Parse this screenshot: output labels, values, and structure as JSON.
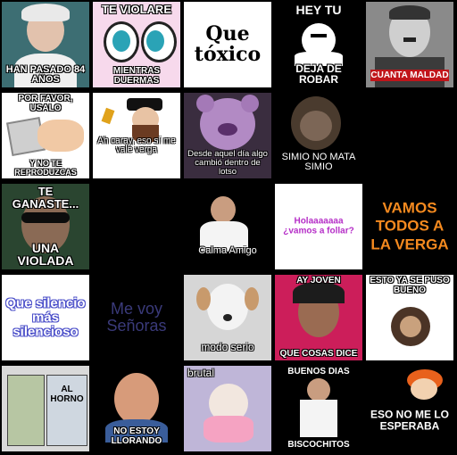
{
  "tiles": [
    {
      "id": "t1",
      "caption": "HAN PASADO 84 AÑOS",
      "bg": "#3d6e73",
      "icon": "elderly-woman-icon"
    },
    {
      "id": "t2",
      "caption_top": "TE VIOLARE",
      "caption_bottom": "MIENTRAS DUERMAS",
      "bg": "#f7d9ec",
      "icon": "cartoon-eyes-icon"
    },
    {
      "id": "t3",
      "caption": "Que tóxico",
      "bg": "#ffffff"
    },
    {
      "id": "t4",
      "caption_top": "HEY TU",
      "caption_bottom": "DEJA DE ROBAR",
      "bg": "#000000",
      "icon": "cartoon-face-icon"
    },
    {
      "id": "t5",
      "caption": "CUANTA MALDAD",
      "bg": "#8a8a8a",
      "icon": "mustache-man-icon"
    },
    {
      "id": "t6",
      "caption_top": "POR FAVOR, USALO",
      "caption_bottom": "Y NO TE REPRODUZCAS",
      "bg": "#ffffff",
      "icon": "condom-icon"
    },
    {
      "id": "t7",
      "caption": "Ah caray, eso sí me vale verga",
      "bg": "#ffffff",
      "icon": "rabbi-icon"
    },
    {
      "id": "t8",
      "caption": "Desde aquel día algo cambió dentro de lotso",
      "bg": "#3a2d3f",
      "icon": "bear-icon"
    },
    {
      "id": "t9",
      "caption": "SIMIO NO MATA SIMIO",
      "bg": "#000000",
      "icon": "ape-icon"
    },
    {
      "id": "t10",
      "caption": "",
      "bg": "#000000"
    },
    {
      "id": "t11",
      "caption_top": "TE GANASTE...",
      "caption_bottom": "UNA VIOLADA",
      "bg": "#2a4530",
      "icon": "sunglasses-man-icon"
    },
    {
      "id": "t12",
      "caption": "",
      "bg": "#000000"
    },
    {
      "id": "t13",
      "caption": "Calma Amigo",
      "bg": "#000000",
      "icon": "footballer-icon"
    },
    {
      "id": "t14",
      "caption": "Holaaaaaaa ¿vamos a follar?",
      "bg": "#ffffff"
    },
    {
      "id": "t15",
      "caption": "VAMOS TODOS A LA VERGA",
      "bg": "#000000"
    },
    {
      "id": "t16",
      "caption": "Que silencio más silencioso",
      "bg": "#ffffff"
    },
    {
      "id": "t17",
      "caption": "Me voy Señoras",
      "bg": "#000000"
    },
    {
      "id": "t18",
      "caption": "modo serio",
      "bg": "#d6d6d6",
      "icon": "dog-icon"
    },
    {
      "id": "t19",
      "caption_top": "AY JOVEN",
      "caption_bottom": "QUE COSAS DICE",
      "bg": "#cc1e5a",
      "icon": "laughing-woman-icon"
    },
    {
      "id": "t20",
      "caption_top": "ESTO YA SE PUSO BUENO",
      "bg": "#ffffff",
      "icon": "chimp-icon"
    },
    {
      "id": "t21",
      "caption": "AL HORNO",
      "bg": "#d9d9d9",
      "icon": "comic-icon"
    },
    {
      "id": "t22",
      "caption": "NO ESTOY LLORANDO",
      "bg": "#000000",
      "icon": "crying-man-icon"
    },
    {
      "id": "t23",
      "caption": "brutal",
      "bg": "#bfb6d8",
      "icon": "small-dog-icon"
    },
    {
      "id": "t24",
      "caption_top": "BUENOS DIAS",
      "caption_bottom": "BISCOCHITOS",
      "bg": "#000000",
      "icon": "man-white-shirt-icon"
    },
    {
      "id": "t25",
      "caption": "ESO NO ME LO ESPERABA",
      "bg": "#000000",
      "icon": "cartoon-cap-icon"
    }
  ]
}
